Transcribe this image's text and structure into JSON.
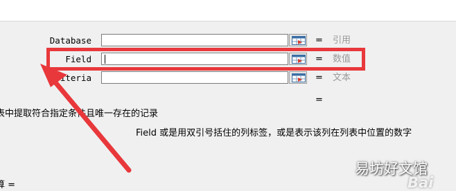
{
  "dialog": {
    "args": [
      {
        "label": "Database",
        "value": "引用",
        "equals": "="
      },
      {
        "label": "Field",
        "value": "数值",
        "equals": "="
      },
      {
        "label": "iteria",
        "value": "文本",
        "equals": "="
      }
    ],
    "result_equals": "=",
    "summary_text": "表中提取符合指定条件且唯一存在的记录",
    "field_description": "Field  或是用双引号括住的列标签，或是表示该列在列表中位置的数字",
    "bottom_label": "算 ="
  },
  "annotation": {
    "highlight_color": "#e8383b"
  },
  "watermark": {
    "text": "易坊好文馆",
    "logo": "Bai"
  },
  "icons": {
    "ref_button": "range-select-icon"
  }
}
